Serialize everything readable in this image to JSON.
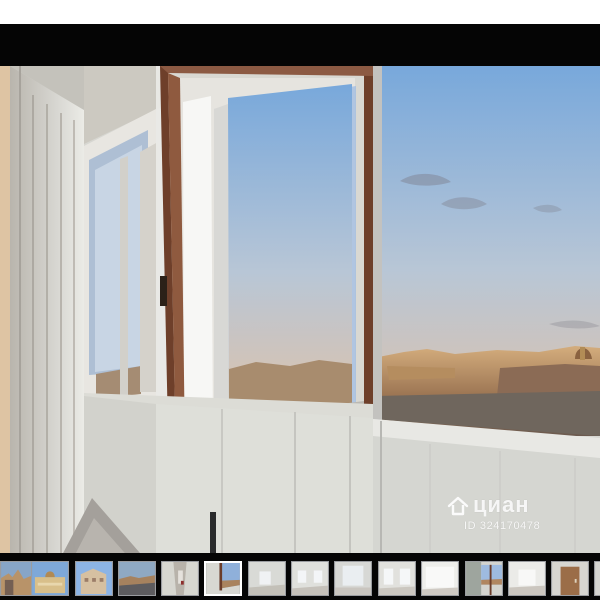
{
  "gallery": {
    "main_image": {
      "description_icon": "balcony-city-view-photo",
      "watermark": {
        "brand": "циан",
        "id_text": "ID 324170478",
        "logo_icon": "cian-house-icon"
      }
    },
    "thumbnails": [
      {
        "icon": "city-buildings-thumbnail"
      },
      {
        "icon": "palace-thumbnail"
      },
      {
        "icon": "building-exterior-thumbnail"
      },
      {
        "icon": "panorama-thumbnail"
      },
      {
        "icon": "hallway-thumbnail"
      },
      {
        "icon": "balcony-window-thumbnail"
      },
      {
        "icon": "empty-room-thumbnail"
      },
      {
        "icon": "empty-room-windows-thumbnail"
      },
      {
        "icon": "interior-room-thumbnail"
      },
      {
        "icon": "interior-room-thumbnail-2"
      },
      {
        "icon": "white-room-thumbnail"
      },
      {
        "icon": "window-view-thumbnail"
      },
      {
        "icon": "white-interior-thumbnail"
      },
      {
        "icon": "door-thumbnail"
      },
      {
        "icon": "edge-thumbnail"
      }
    ],
    "active_thumbnail_index": 5,
    "colors": {
      "viewer_background": "#050505",
      "sky": "#8fb0d8",
      "city": "#b28b62",
      "frame": "#6b3d2a",
      "wall": "#d3d3cf"
    }
  }
}
